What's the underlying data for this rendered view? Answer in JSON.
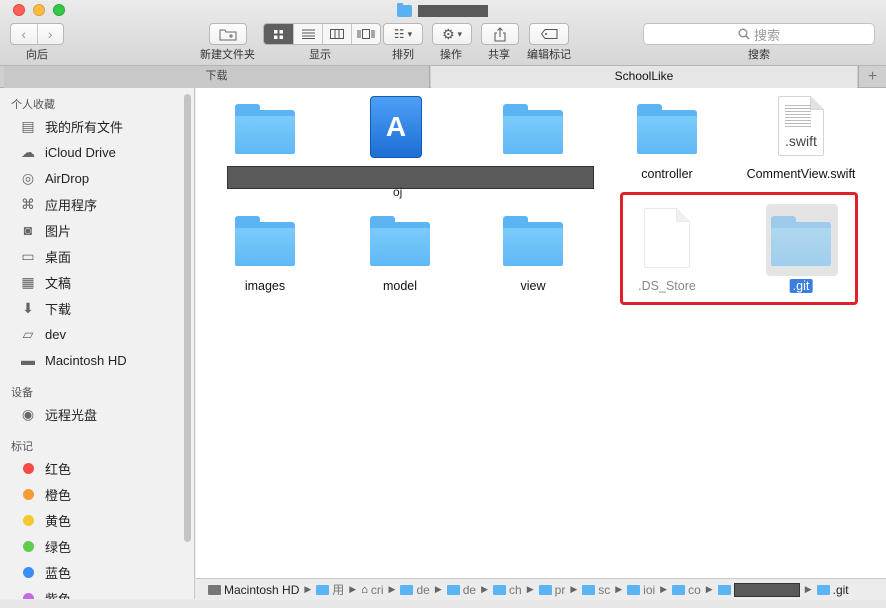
{
  "toolbar": {
    "nav_label": "向后",
    "back_arrow": "‹",
    "forward_arrow": "›",
    "new_folder_label": "新建文件夹",
    "view_label": "显示",
    "arrange_label": "排列",
    "action_label": "操作",
    "share_label": "共享",
    "tags_label": "编辑标记",
    "search_placeholder": "搜索",
    "search_label": "搜索"
  },
  "tabs": [
    {
      "label": "下载"
    },
    {
      "label": "SchoolLike"
    }
  ],
  "tab_add": "+",
  "sidebar": {
    "favorites_header": "个人收藏",
    "favorites": [
      {
        "label": "我的所有文件",
        "icon": "all-files-icon"
      },
      {
        "label": "iCloud Drive",
        "icon": "cloud-icon"
      },
      {
        "label": "AirDrop",
        "icon": "airdrop-icon"
      },
      {
        "label": "应用程序",
        "icon": "applications-icon"
      },
      {
        "label": "图片",
        "icon": "camera-icon"
      },
      {
        "label": "桌面",
        "icon": "desktop-icon"
      },
      {
        "label": "文稿",
        "icon": "documents-icon"
      },
      {
        "label": "下载",
        "icon": "download-icon"
      },
      {
        "label": "dev",
        "icon": "folder-icon"
      },
      {
        "label": "Macintosh HD",
        "icon": "hard-drive-icon"
      }
    ],
    "devices_header": "设备",
    "devices": [
      {
        "label": "远程光盘",
        "icon": "disc-icon"
      }
    ],
    "tags_header": "标记",
    "tags": [
      {
        "label": "红色",
        "color": "#f74a47"
      },
      {
        "label": "橙色",
        "color": "#f79a36"
      },
      {
        "label": "黄色",
        "color": "#f5c92d"
      },
      {
        "label": "绿色",
        "color": "#5fcc4c"
      },
      {
        "label": "蓝色",
        "color": "#3a8ef6"
      },
      {
        "label": "紫色",
        "color": "#c36be0"
      }
    ]
  },
  "files": [
    {
      "name": "",
      "type": "folder"
    },
    {
      "name": "oj",
      "type": "xcode-project"
    },
    {
      "name": "",
      "type": "folder"
    },
    {
      "name": "controller",
      "type": "folder"
    },
    {
      "name": "CommentView.swift",
      "type": "swift-file",
      "ext": ".swift"
    },
    {
      "name": "images",
      "type": "folder"
    },
    {
      "name": "model",
      "type": "folder"
    },
    {
      "name": "view",
      "type": "folder"
    },
    {
      "name": ".DS_Store",
      "type": "document"
    },
    {
      "name": ".git",
      "type": "folder"
    }
  ],
  "pathbar": {
    "items": [
      "Macintosh HD",
      "用",
      "cri",
      "de",
      "de",
      "ch",
      "pr",
      "sc",
      "ioi",
      "co",
      "",
      ".git"
    ]
  }
}
